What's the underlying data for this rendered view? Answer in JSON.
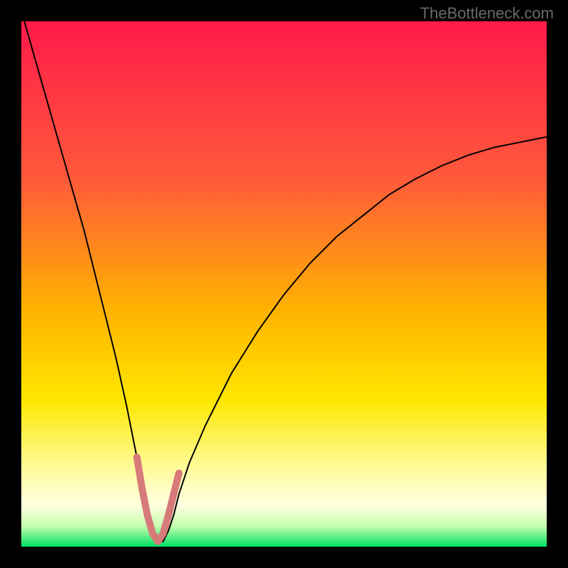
{
  "watermark": "TheBottleneck.com",
  "chart_data": {
    "type": "line",
    "title": "",
    "xlabel": "",
    "ylabel": "",
    "xlim": [
      0,
      100
    ],
    "ylim": [
      0,
      100
    ],
    "background_gradient": {
      "stops": [
        {
          "offset": 0,
          "color": "#ff1a4a"
        },
        {
          "offset": 30,
          "color": "#ff5a3a"
        },
        {
          "offset": 55,
          "color": "#ffb300"
        },
        {
          "offset": 72,
          "color": "#ffe600"
        },
        {
          "offset": 85,
          "color": "#fffc9a"
        },
        {
          "offset": 92,
          "color": "#ffffe0"
        },
        {
          "offset": 96,
          "color": "#c8ffb0"
        },
        {
          "offset": 100,
          "color": "#00e060"
        }
      ]
    },
    "series": [
      {
        "name": "bottleneck-curve",
        "color": "#000000",
        "stroke_width": 2,
        "x": [
          0,
          2,
          4,
          6,
          8,
          10,
          12,
          14,
          16,
          18,
          20,
          22,
          23,
          24,
          25,
          26,
          27,
          28,
          29,
          30,
          32,
          35,
          40,
          45,
          50,
          55,
          60,
          65,
          70,
          75,
          80,
          85,
          90,
          95,
          100
        ],
        "y": [
          102,
          95,
          88,
          81,
          74,
          67,
          60,
          52,
          44,
          36,
          27,
          17,
          12,
          7,
          3,
          1,
          1,
          3,
          6,
          10,
          16,
          23,
          33,
          41,
          48,
          54,
          59,
          63,
          67,
          70,
          72.5,
          74.5,
          76,
          77,
          78
        ]
      },
      {
        "name": "optimal-zone-marker",
        "color": "#d77a7a",
        "stroke_width": 10,
        "linecap": "round",
        "x": [
          22,
          23,
          24,
          25,
          26,
          27,
          28,
          29,
          30
        ],
        "y": [
          17,
          11,
          6,
          2.5,
          1,
          2.5,
          6,
          10,
          14
        ]
      }
    ]
  }
}
